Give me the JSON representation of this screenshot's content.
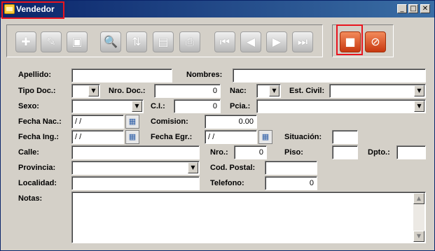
{
  "window": {
    "title": "Vendedor",
    "icon": "folder-icon"
  },
  "caption_buttons": {
    "minimize": "_",
    "maximize": "□",
    "close": "✕"
  },
  "toolbar": {
    "icons": {
      "add": "✚",
      "edit": "✎",
      "delete": "▣",
      "search": "🔍",
      "sort": "⇅",
      "report": "▤",
      "print": "⎙",
      "first": "⏮",
      "prev": "◀",
      "next": "▶",
      "last": "⏭",
      "save": "■",
      "cancel": "⊘"
    }
  },
  "labels": {
    "apellido": "Apellido:",
    "nombres": "Nombres:",
    "tipo_doc": "Tipo Doc.:",
    "nro_doc": "Nro. Doc.:",
    "nac": "Nac:",
    "est_civil": "Est. Civil:",
    "sexo": "Sexo:",
    "ci": "C.I.:",
    "pcia": "Pcia.:",
    "fecha_nac": "Fecha Nac.:",
    "comision": "Comision:",
    "fecha_ing": "Fecha Ing.:",
    "fecha_egr": "Fecha Egr.:",
    "situacion": "Situación:",
    "calle": "Calle:",
    "nro": "Nro.:",
    "piso": "Piso:",
    "dpto": "Dpto.:",
    "provincia": "Provincia:",
    "cod_postal": "Cod. Postal:",
    "localidad": "Localidad:",
    "telefono": "Telefono:",
    "notas": "Notas:"
  },
  "values": {
    "apellido": "",
    "nombres": "",
    "tipo_doc": "",
    "nro_doc": "0",
    "nac": "",
    "est_civil": "",
    "sexo": "",
    "ci": "0",
    "pcia": "",
    "fecha_nac": " / /",
    "comision": "0.00",
    "fecha_ing": " / /",
    "fecha_egr": " / /",
    "situacion": "",
    "calle": "",
    "nro": "0",
    "piso": "",
    "dpto": "",
    "provincia": "",
    "cod_postal": "",
    "localidad": "",
    "telefono": "0",
    "notas": ""
  },
  "colors": {
    "accent_orange": "#d0461a",
    "highlight_red": "#e8141e",
    "title_bar": "#0a246a"
  }
}
